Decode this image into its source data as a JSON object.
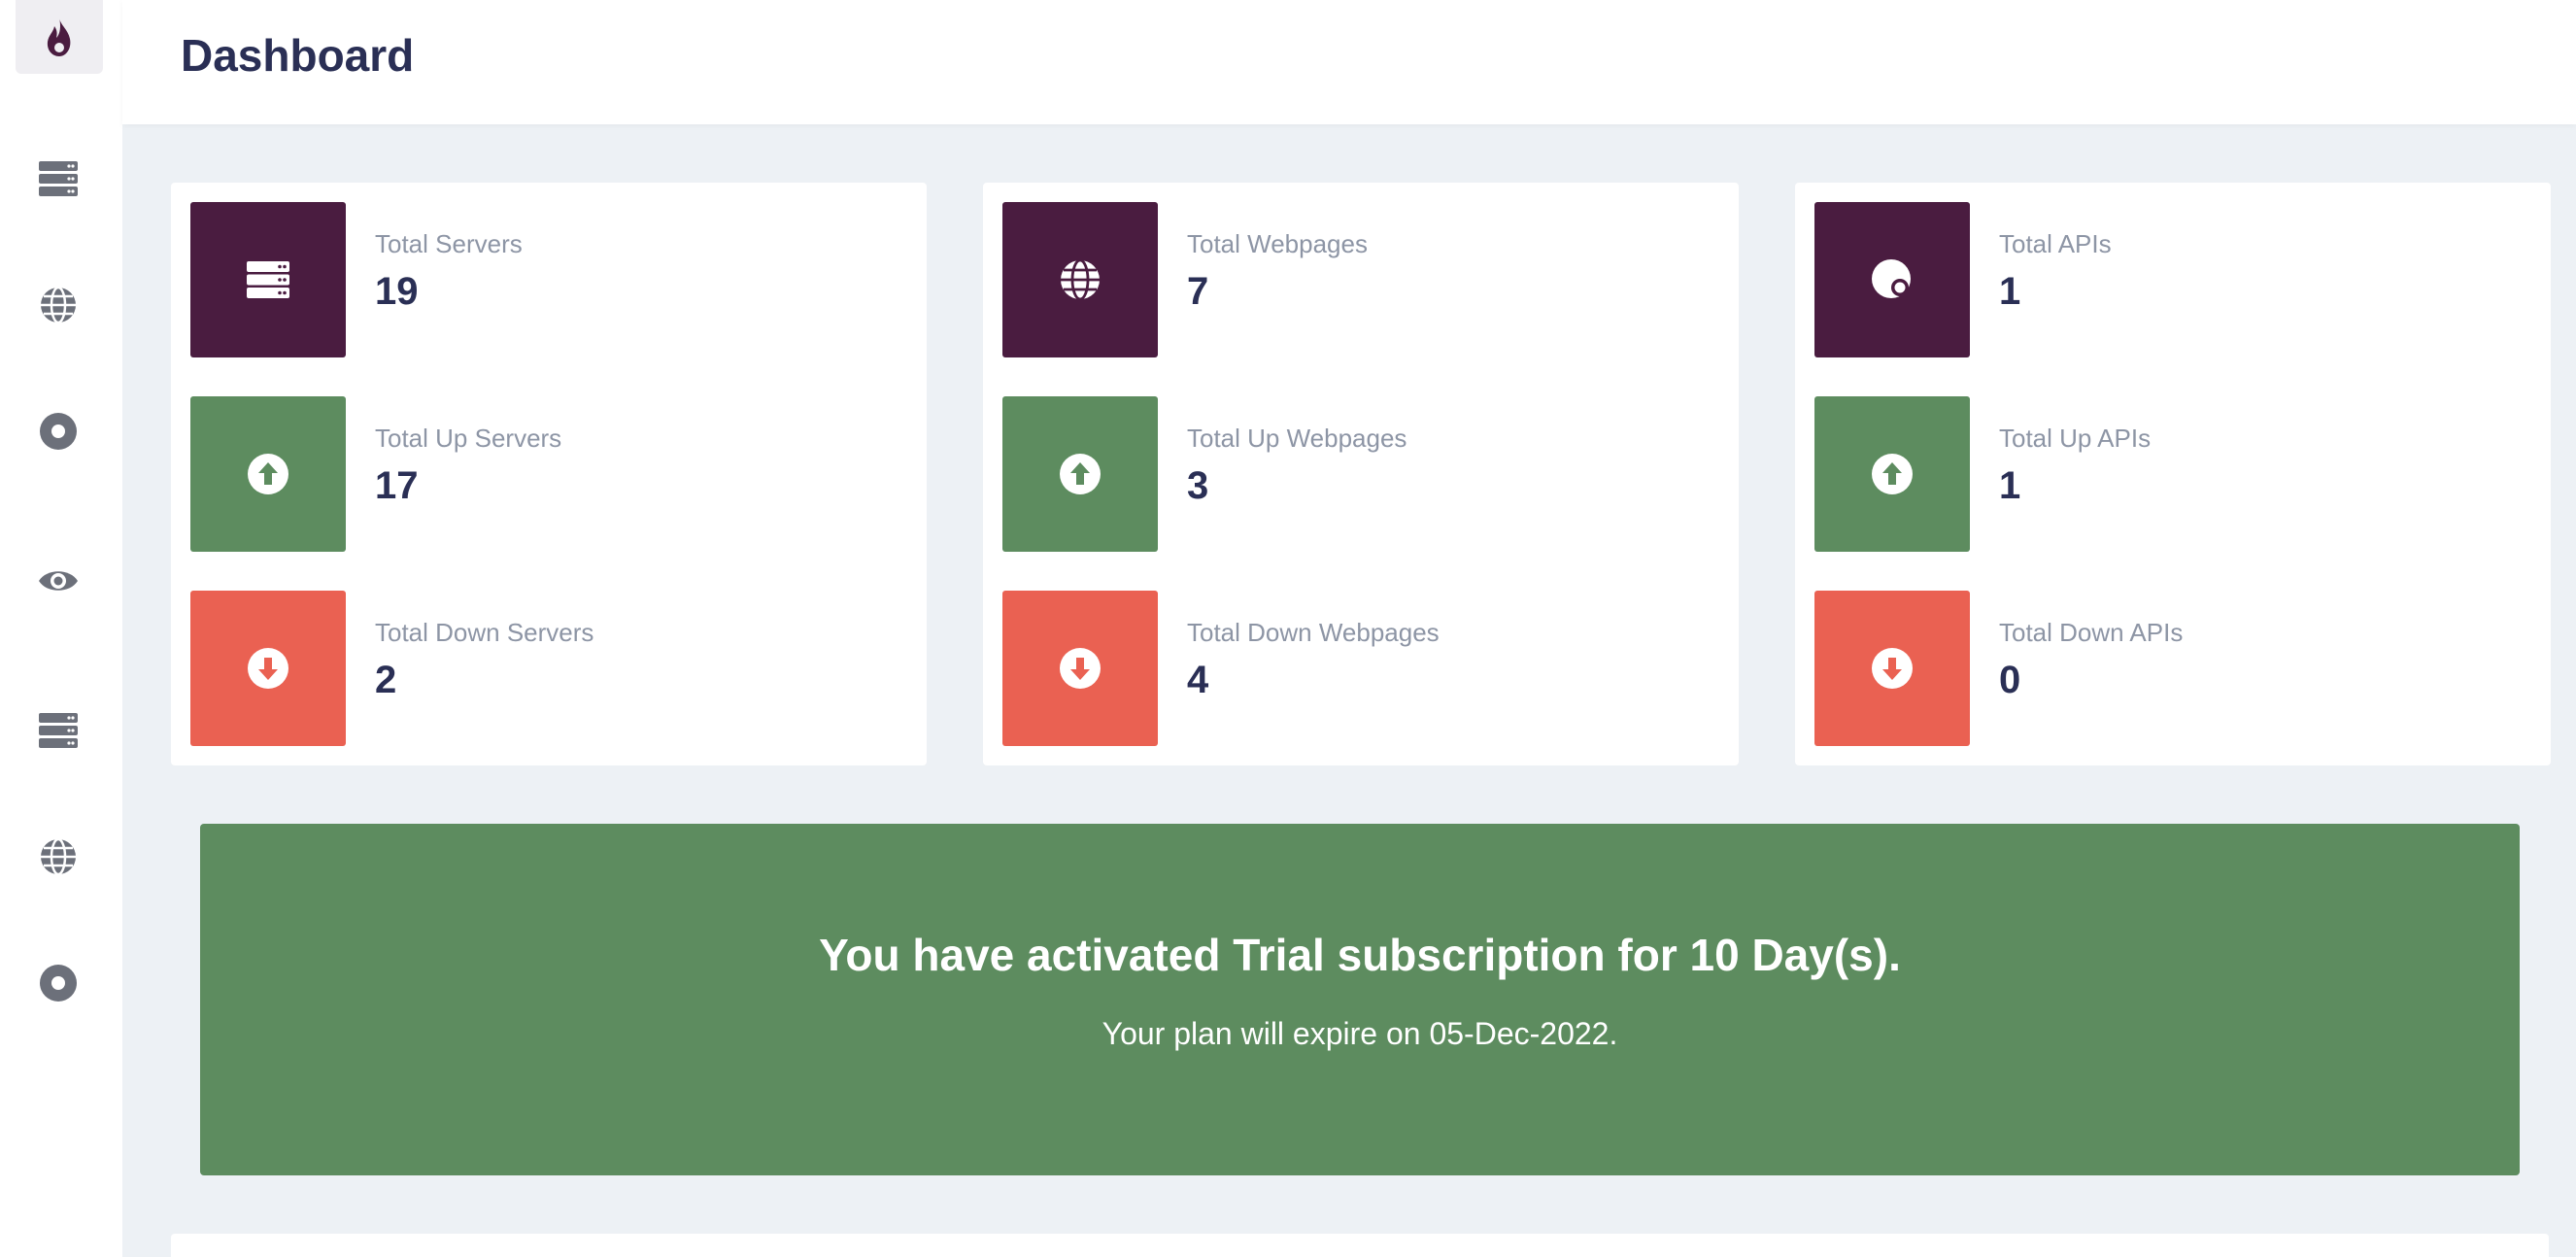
{
  "header": {
    "title": "Dashboard"
  },
  "sidebar": {
    "items": [
      {
        "icon": "server-icon"
      },
      {
        "icon": "globe-icon"
      },
      {
        "icon": "api-icon"
      },
      {
        "icon": "eye-icon"
      },
      {
        "icon": "server-icon"
      },
      {
        "icon": "globe-icon"
      },
      {
        "icon": "api-icon"
      }
    ]
  },
  "cards": {
    "servers": {
      "total": {
        "label": "Total Servers",
        "value": "19"
      },
      "up": {
        "label": "Total Up Servers",
        "value": "17"
      },
      "down": {
        "label": "Total Down Servers",
        "value": "2"
      }
    },
    "webpages": {
      "total": {
        "label": "Total Webpages",
        "value": "7"
      },
      "up": {
        "label": "Total Up Webpages",
        "value": "3"
      },
      "down": {
        "label": "Total Down Webpages",
        "value": "4"
      }
    },
    "apis": {
      "total": {
        "label": "Total APIs",
        "value": "1"
      },
      "up": {
        "label": "Total Up APIs",
        "value": "1"
      },
      "down": {
        "label": "Total Down APIs",
        "value": "0"
      }
    }
  },
  "banner": {
    "title": "You have activated Trial subscription for 10 Day(s).",
    "subtitle": "Your plan will expire on 05-Dec-2022."
  },
  "colors": {
    "brand": "#4a1c40",
    "up": "#5d8c5f",
    "down": "#ea6152",
    "text": "#2a2f55",
    "muted": "#8d95a5",
    "background": "#edf1f5"
  }
}
